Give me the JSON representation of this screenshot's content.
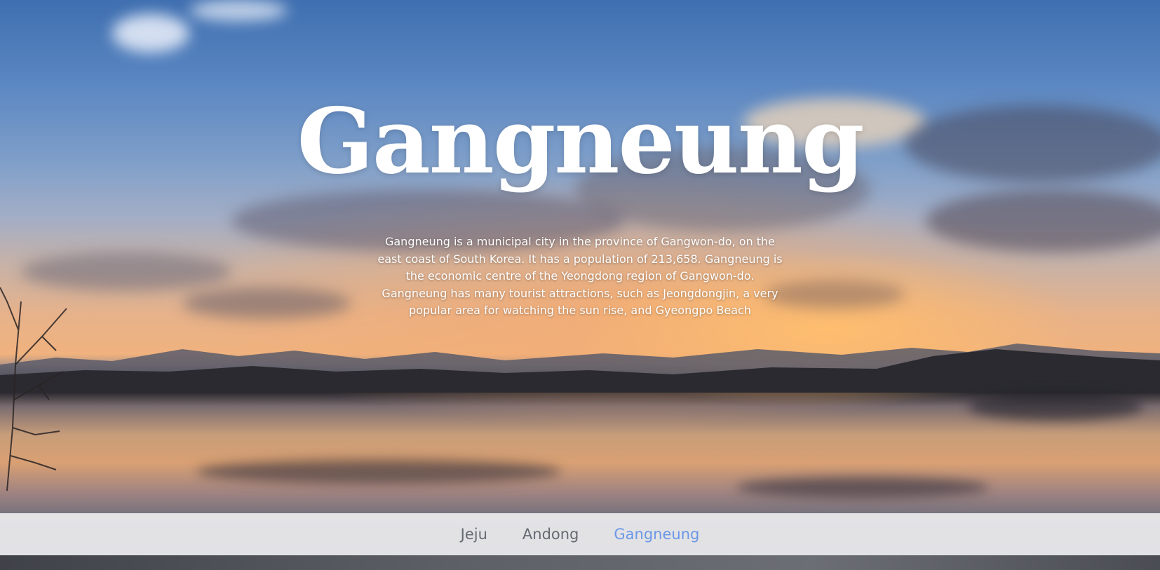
{
  "hero": {
    "title": "Gangneung",
    "description": "Gangneung is a municipal city in the province of Gangwon-do, on the east coast of South Korea. It has a population of 213,658. Gangneung is the economic centre of the Yeongdong region of Gangwon-do. Gangneung has many tourist attractions, such as Jeongdongjin, a very popular area for watching the sun rise, and Gyeongpo Beach"
  },
  "nav": {
    "items": [
      {
        "label": "Jeju",
        "active": false
      },
      {
        "label": "Andong",
        "active": false
      },
      {
        "label": "Gangneung",
        "active": true
      }
    ]
  },
  "colors": {
    "nav_background": "#ececee",
    "nav_text": "#666a70",
    "nav_active": "#6b98e6",
    "title_text": "#ffffff"
  }
}
